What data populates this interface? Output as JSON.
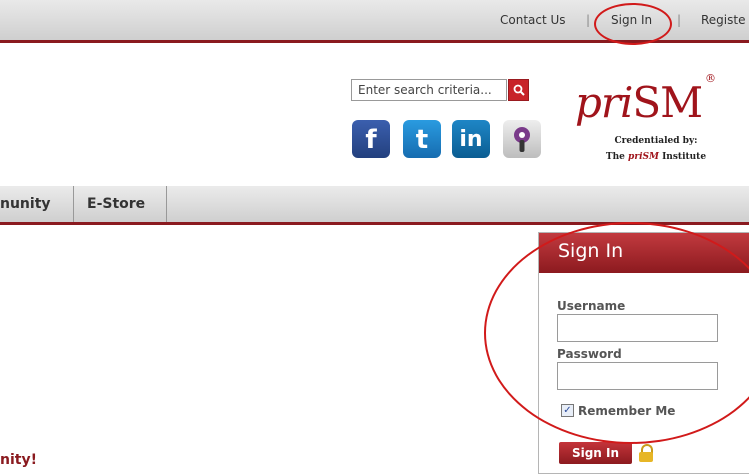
{
  "topbar": {
    "contact": "Contact Us",
    "sep1": "|",
    "signin": "Sign In",
    "sep2": "|",
    "register": "Registe"
  },
  "search": {
    "placeholder": "Enter search criteria...",
    "button_icon": "search-icon"
  },
  "social": [
    "facebook-icon",
    "twitter-icon",
    "linkedin-icon",
    "podcast-icon"
  ],
  "logo": {
    "text_pri": "pri",
    "text_sm": "SM",
    "registered": "®",
    "credentialed_by": "Credentialed by:",
    "institute_pre": "The ",
    "institute_brand": "priSM",
    "institute_post": " Institute"
  },
  "nav": {
    "items": [
      "nunity",
      "E-Store"
    ]
  },
  "signin_panel": {
    "title": "Sign In",
    "username_label": "Username",
    "password_label": "Password",
    "remember_label": "Remember Me",
    "remember_checked": true,
    "button_label": "Sign In"
  },
  "page": {
    "bottom_text": "nity!"
  },
  "colors": {
    "accent": "#8a1a1f",
    "annotation": "#d11a1a"
  }
}
